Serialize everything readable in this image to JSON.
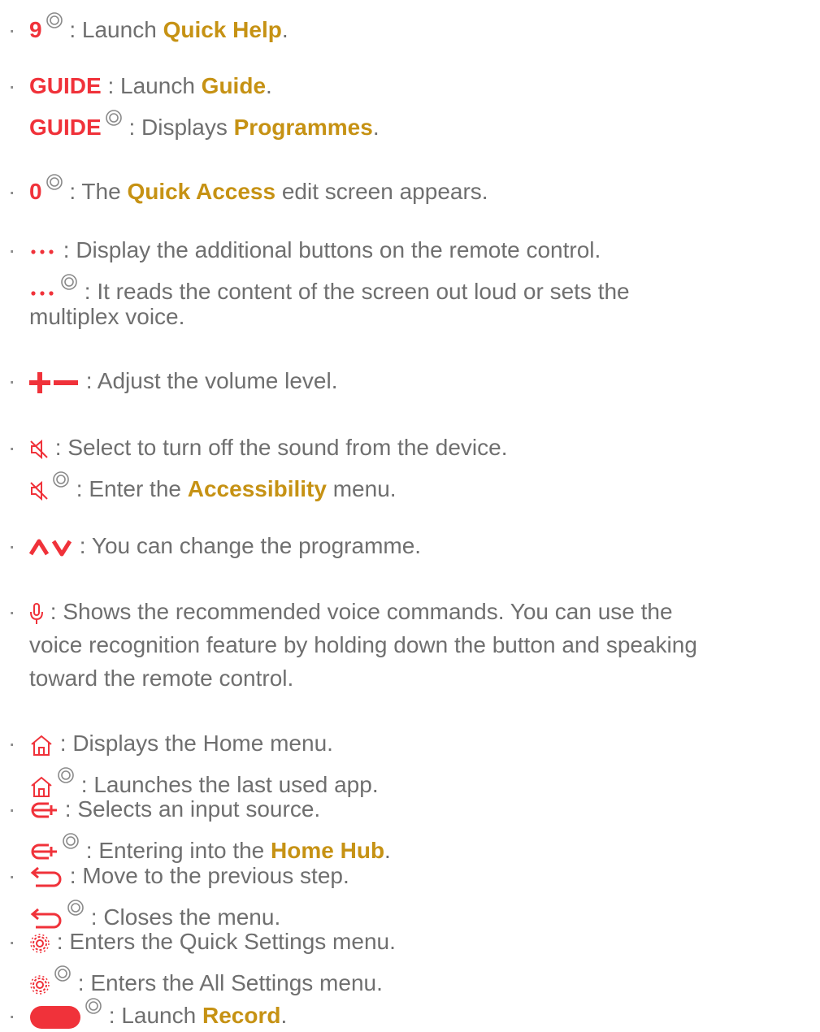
{
  "bullet": "·",
  "colors": {
    "key": "#f0323a",
    "feature": "#c69214",
    "text": "#6f6f6f",
    "icon": "#f0323a"
  },
  "hold_icon": "double-circle-icon",
  "items": [
    {
      "lines": [
        {
          "key": "9",
          "hold": true,
          "pre": " : Launch ",
          "feature": "Quick Help",
          "post": "."
        }
      ]
    },
    {
      "lines": [
        {
          "key": "GUIDE",
          "pre": " : Launch ",
          "feature": "Guide",
          "post": "."
        },
        {
          "key": "GUIDE",
          "hold": true,
          "pre": " : Displays ",
          "feature": "Programmes",
          "post": "."
        }
      ]
    },
    {
      "lines": [
        {
          "key": "0",
          "hold": true,
          "pre": " : The ",
          "feature": "Quick Access",
          "post": " edit screen appears."
        }
      ]
    },
    {
      "lines": [
        {
          "icon": "more-dots-icon",
          "text": " : Display the additional buttons on the remote control."
        },
        {
          "icon": "more-dots-icon",
          "hold": true,
          "text": " : It reads the content of the screen out loud or sets the"
        },
        {
          "text": "multiplex voice."
        }
      ]
    },
    {
      "lines": [
        {
          "icon": "volume-plus-minus-icon",
          "text": " : Adjust the volume level."
        }
      ]
    },
    {
      "lines": [
        {
          "icon": "mute-icon",
          "text": " : Select to turn off the sound from the device."
        },
        {
          "icon": "mute-icon",
          "hold": true,
          "pre": " : Enter the ",
          "feature": "Accessibility",
          "post": " menu."
        }
      ]
    },
    {
      "lines": [
        {
          "icon": "channel-up-down-icon",
          "text": " : You can change the programme."
        }
      ]
    },
    {
      "lines": [
        {
          "icon": "microphone-icon",
          "text": " : Shows the recommended voice commands. You can use the"
        },
        {
          "text": "voice recognition feature by holding down the button and speaking"
        },
        {
          "text": "toward the remote control."
        }
      ]
    },
    {
      "lines": [
        {
          "icon": "home-icon",
          "text": " : Displays the Home menu."
        },
        {
          "icon": "home-icon",
          "hold": true,
          "text": " : Launches the last used app."
        }
      ]
    },
    {
      "lines": [
        {
          "icon": "input-source-icon",
          "text": " : Selects an input source."
        },
        {
          "icon": "input-source-icon",
          "hold": true,
          "pre": " : Entering into the ",
          "feature": "Home Hub",
          "post": "."
        }
      ]
    },
    {
      "lines": [
        {
          "icon": "back-icon",
          "text": " : Move to the previous step."
        },
        {
          "icon": "back-icon",
          "hold": true,
          "text": " : Closes the menu."
        }
      ]
    },
    {
      "lines": [
        {
          "icon": "settings-icon",
          "text": " : Enters the Quick Settings menu."
        },
        {
          "icon": "settings-icon",
          "hold": true,
          "text": " : Enters the All Settings menu."
        }
      ]
    },
    {
      "lines": [
        {
          "icon": "record-button-icon",
          "hold": true,
          "pre": " : Launch ",
          "feature": "Record",
          "post": "."
        }
      ]
    }
  ]
}
